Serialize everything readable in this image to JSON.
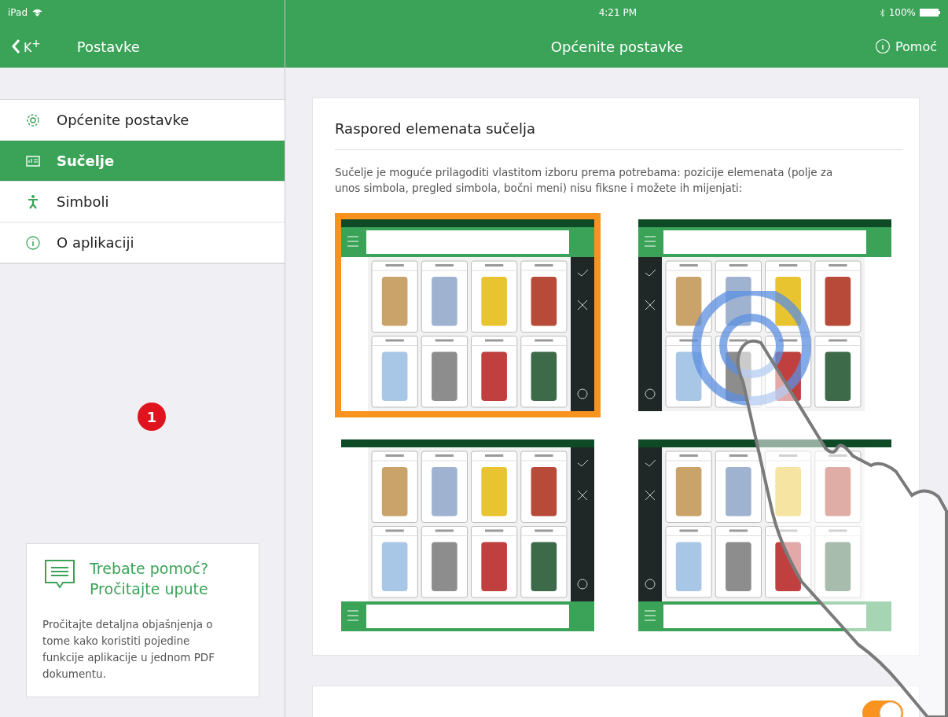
{
  "status_bar": {
    "device": "iPad",
    "time": "4:21 PM",
    "battery": "100%"
  },
  "sidebar": {
    "back_label": "K$^{+}$",
    "title": "Postavke",
    "items": [
      {
        "label": "Općenite postavke",
        "selected": false
      },
      {
        "label": "Sučelje",
        "selected": true
      },
      {
        "label": "Simboli",
        "selected": false
      },
      {
        "label": "O aplikaciji",
        "selected": false
      }
    ],
    "marker": "1",
    "help_card": {
      "title": "Trebate pomoć? Pročitajte upute",
      "text": "Pročitajte detaljna objašnjenja o tome kako koristiti pojedine funkcije aplikacije u jednom PDF dokumentu."
    }
  },
  "header": {
    "title": "Općenite postavke",
    "help_label": "Pomoć"
  },
  "layout_section": {
    "title": "Raspored elemenata sučelja",
    "description": "Sučelje je moguće prilagoditi vlastitom izboru prema potrebama: pozicije elemenata (polje za unos simbola, pregled simbola, bočni meni) nisu fiksne i možete ih mijenjati:",
    "layouts": [
      {
        "kind": "topright",
        "selected": true
      },
      {
        "kind": "topleft",
        "selected": false
      },
      {
        "kind": "bottomright",
        "selected": false
      },
      {
        "kind": "bottomleft",
        "selected": false
      }
    ]
  },
  "toggle_section": {
    "on": true
  }
}
